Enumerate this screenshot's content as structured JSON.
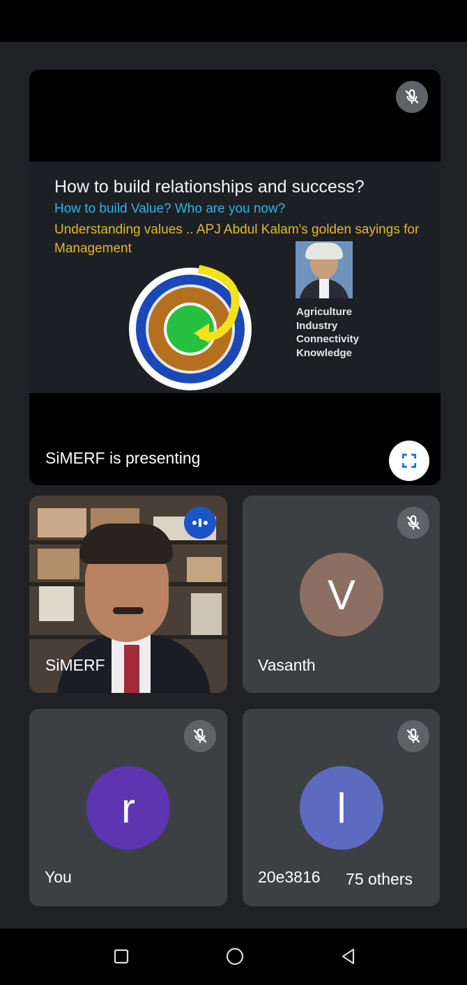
{
  "presentation": {
    "presenter_label": "SiMERF is presenting",
    "slide": {
      "title": "How to build relationships and success?",
      "subtitle": "How to build Value? Who are you now?",
      "subtitle2": "Understanding values .. APJ Abdul Kalam's golden sayings for Management",
      "list": [
        "Agriculture",
        "Industry",
        "Connectivity",
        "Knowledge"
      ]
    }
  },
  "participants": [
    {
      "name": "SiMERF",
      "type": "video",
      "speaking": true
    },
    {
      "name": "Vasanth",
      "initial": "V",
      "avatar_color": "#8d6e63",
      "muted": true
    },
    {
      "name": "You",
      "initial": "r",
      "avatar_color": "#5e35b1",
      "muted": true
    },
    {
      "name": "20e3816",
      "initial": "l",
      "avatar_color": "#5c6bc0",
      "muted": true
    }
  ],
  "others_label": "75 others",
  "icons": {
    "mute": "mic-off-icon",
    "fullscreen": "fullscreen-icon",
    "speaking": "audio-level-icon",
    "nav": [
      "recents-icon",
      "home-icon",
      "back-icon"
    ]
  }
}
